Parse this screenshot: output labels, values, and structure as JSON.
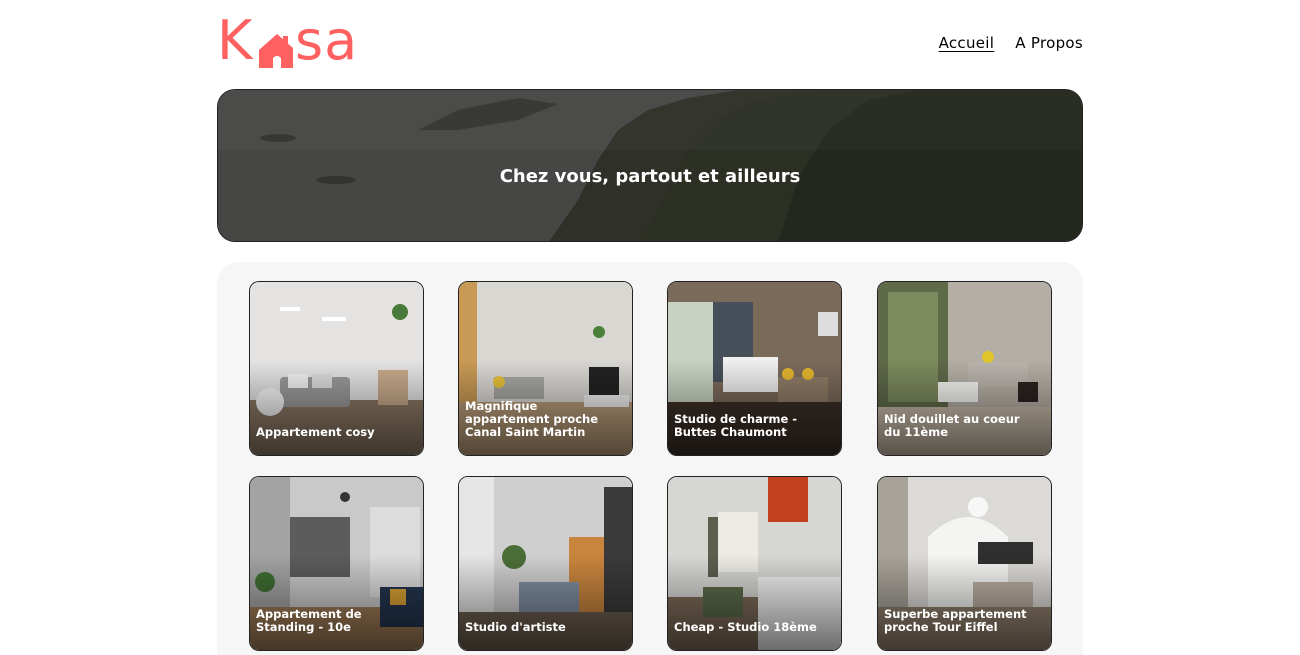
{
  "brand": {
    "logo_text_left": "K",
    "logo_text_right": "sa",
    "accent_color": "#FF6060"
  },
  "nav": {
    "items": [
      {
        "label": "Accueil",
        "active": true
      },
      {
        "label": "A Propos",
        "active": false
      }
    ]
  },
  "banner": {
    "title": "Chez vous, partout et ailleurs"
  },
  "listings": [
    {
      "title": "Appartement cosy"
    },
    {
      "title": "Magnifique appartement proche Canal Saint Martin"
    },
    {
      "title": "Studio de charme - Buttes Chaumont"
    },
    {
      "title": "Nid douillet au coeur du 11ème"
    },
    {
      "title": "Appartement de Standing - 10e"
    },
    {
      "title": "Studio d'artiste"
    },
    {
      "title": "Cheap - Studio 18ème"
    },
    {
      "title": "Superbe appartement proche Tour Eiffel"
    }
  ]
}
